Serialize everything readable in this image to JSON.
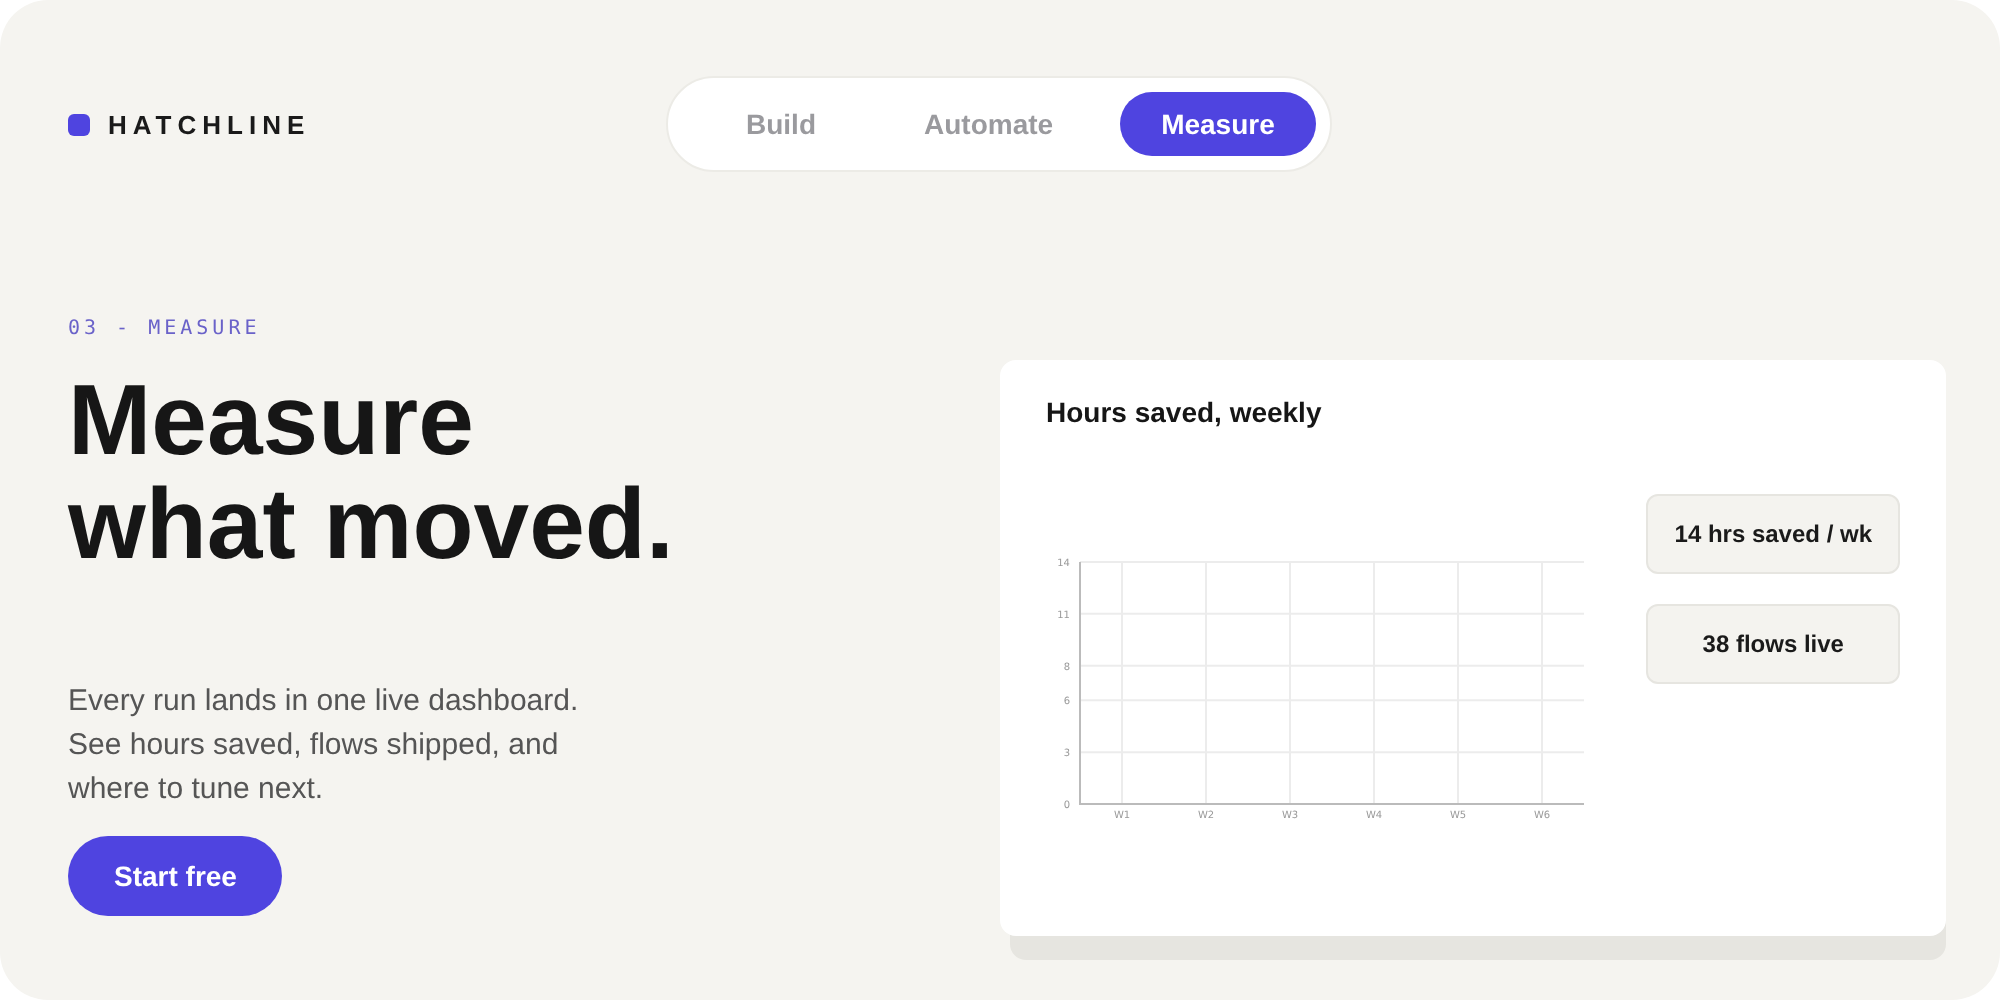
{
  "brand": {
    "name": "HATCHLINE"
  },
  "tabs": [
    {
      "label": "Build",
      "selected": false
    },
    {
      "label": "Automate",
      "selected": false
    },
    {
      "label": "Measure",
      "selected": true
    }
  ],
  "hero": {
    "eyebrow": "03 - MEASURE",
    "title_lines": [
      "Measure",
      "what moved."
    ],
    "body_lines": [
      "Every run lands in one live dashboard.",
      "See hours saved, flows shipped, and",
      "where to tune next."
    ],
    "cta": "Start free"
  },
  "card": {
    "title": "Hours saved, weekly",
    "chart_data": {
      "type": "line",
      "categories": [
        "W1",
        "W2",
        "W3",
        "W4",
        "W5",
        "W6"
      ],
      "ylim": [
        0,
        14
      ],
      "yticks": [
        0,
        3,
        6,
        8,
        11,
        14
      ],
      "grid": true
    },
    "stats": [
      "14 hrs saved / wk",
      "38 flows live"
    ]
  }
}
